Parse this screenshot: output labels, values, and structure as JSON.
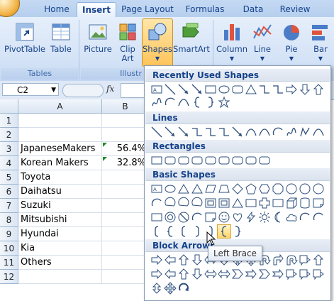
{
  "tabs": [
    "Home",
    "Insert",
    "Page Layout",
    "Formulas",
    "Data",
    "Review"
  ],
  "active_tab": "Insert",
  "ribbon": {
    "groups": [
      {
        "label": "Tables"
      },
      {
        "label": "Illustr"
      }
    ],
    "buttons": {
      "pivot": [
        "PivotTable"
      ],
      "table": [
        "Table"
      ],
      "picture": [
        "Picture"
      ],
      "clipart": [
        "Clip",
        "Art"
      ],
      "shapes": [
        "Shapes"
      ],
      "smartart": [
        "SmartArt"
      ],
      "column": [
        "Column"
      ],
      "line": [
        "Line"
      ],
      "pie": [
        "Pie"
      ],
      "bar": [
        "Bar"
      ]
    }
  },
  "formula_bar": {
    "name_box": "C2",
    "fx": "fx"
  },
  "grid": {
    "columns": [
      "A",
      "B"
    ],
    "rows": [
      "1",
      "2",
      "3",
      "4",
      "5",
      "6",
      "7",
      "8",
      "9",
      "10",
      "11",
      "12"
    ],
    "cells_a": [
      "",
      "",
      "JapaneseMakers",
      "Korean Makers",
      "Toyota",
      "Daihatsu",
      "Suzuki",
      "Mitsubishi",
      "Hyundai",
      "Kia",
      "Others",
      ""
    ],
    "cells_b": [
      "",
      "",
      "56.4%",
      "32.8%",
      "",
      "",
      "",
      "",
      "",
      "",
      "",
      ""
    ]
  },
  "shapes_menu": {
    "sections": [
      "Recently Used Shapes",
      "Lines",
      "Rectangles",
      "Basic Shapes",
      "Block Arrows"
    ],
    "tooltip": "Left Brace"
  },
  "colors": {
    "accent": "#15428b",
    "highlight": "#ffd56b"
  }
}
